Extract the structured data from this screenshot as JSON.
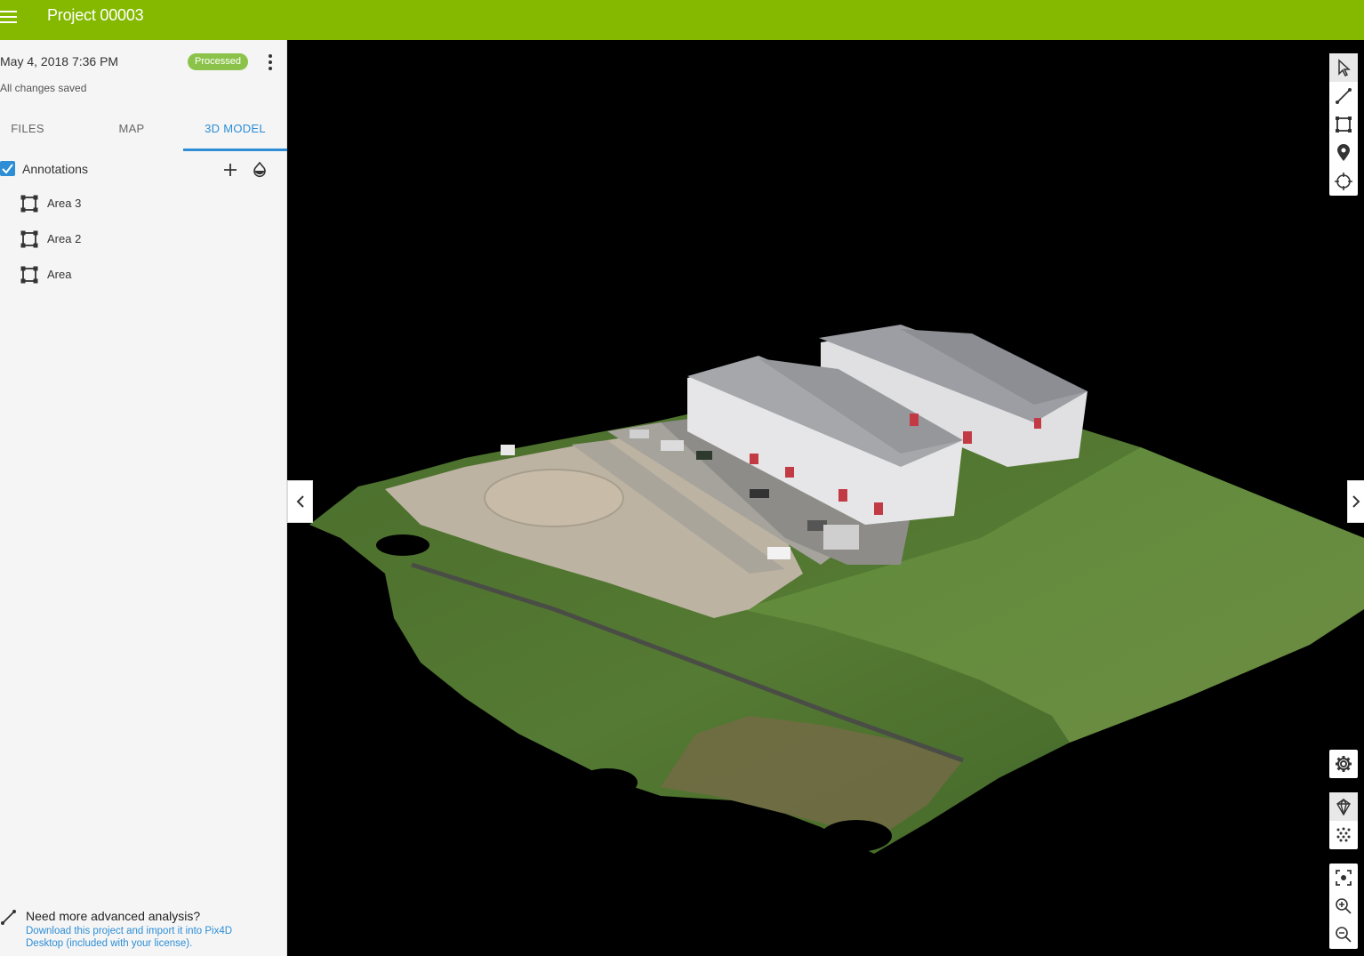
{
  "header": {
    "title": "Project 00003",
    "menu_icon": "menu-icon"
  },
  "project": {
    "date": "May 4, 2018 7:36 PM",
    "status": "Processed",
    "save_status": "All changes saved"
  },
  "tabs": [
    {
      "label": "FILES",
      "active": false
    },
    {
      "label": "MAP",
      "active": false
    },
    {
      "label": "3D MODEL",
      "active": true
    }
  ],
  "annotations": {
    "label": "Annotations",
    "checked": true,
    "items": [
      {
        "label": "Area 3",
        "icon": "area-icon"
      },
      {
        "label": "Area 2",
        "icon": "area-icon"
      },
      {
        "label": "Area",
        "icon": "area-icon"
      }
    ]
  },
  "promo": {
    "title": "Need more advanced analysis?",
    "link": "Download this project and import it into Pix4D Desktop (included with your license)."
  },
  "toolbars": {
    "tools": [
      "select-icon",
      "line-measure-icon",
      "area-measure-icon",
      "marker-icon",
      "crosshair-icon"
    ],
    "view": [
      "settings-icon",
      "mesh-icon",
      "point-cloud-icon"
    ],
    "zoom": [
      "focus-icon",
      "zoom-in-icon",
      "zoom-out-icon"
    ]
  },
  "colors": {
    "brand": "#84b900",
    "accent": "#2d8ed6",
    "status": "#8bc34a"
  }
}
